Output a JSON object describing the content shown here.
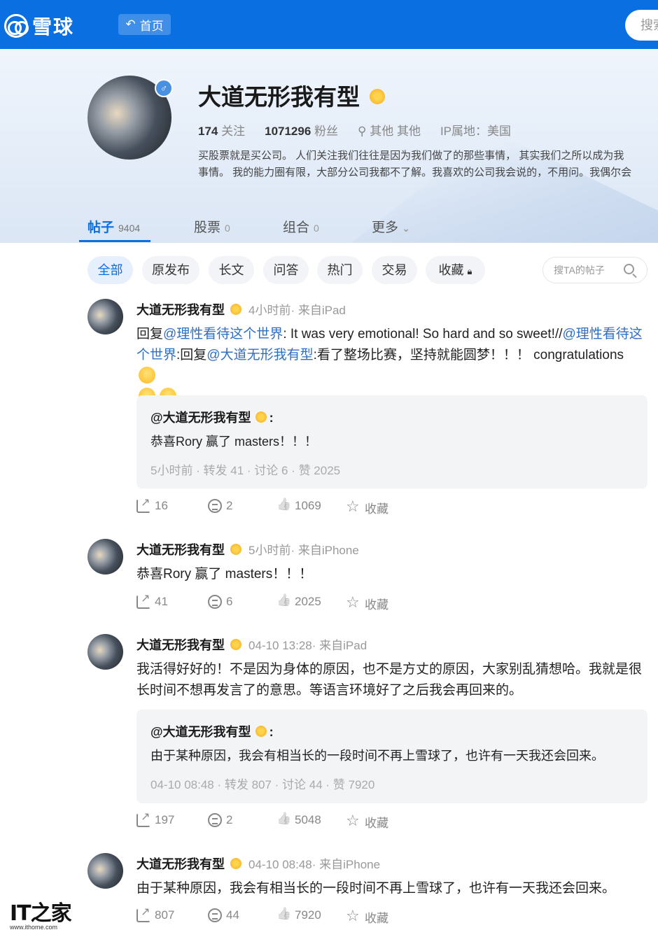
{
  "header": {
    "logo_text": "雪球",
    "home_label": "首页",
    "search_placeholder": "搜索"
  },
  "profile": {
    "name": "大道无形我有型",
    "gender_icon": "♂",
    "following_count": "174",
    "following_label": "关注",
    "followers_count": "1071296",
    "followers_label": "粉丝",
    "location": "其他 其他",
    "ip_location": "IP属地：美国",
    "bio_line1": "买股票就是买公司。 人们关注我们往往是因为我们做了的那些事情， 其实我们之所以成为我",
    "bio_line2": "事情。 我的能力圈有限，大部分公司我都不了解。我喜欢的公司我会说的，不用问。我偶尔会"
  },
  "tabs": [
    {
      "label": "帖子",
      "count": "9404"
    },
    {
      "label": "股票",
      "count": "0"
    },
    {
      "label": "组合",
      "count": "0"
    },
    {
      "label": "更多",
      "count": ""
    }
  ],
  "filters": [
    "全部",
    "原发布",
    "长文",
    "问答",
    "热门",
    "交易",
    "收藏"
  ],
  "post_search_placeholder": "搜TA的帖子",
  "posts": [
    {
      "author": "大道无形我有型",
      "meta": "4小时前· 来自iPad",
      "text": {
        "t1": "回复",
        "m1": "@理性看待这个世界",
        "t2": ": It was very emotional! So hard and so sweet!//",
        "m2": "@理性看待这个世界",
        "t3": ":回复",
        "m3": "@大道无形我有型",
        "t4": ":看了整场比赛，坚持就能圆梦！！！ congratulations"
      },
      "quote": {
        "author": "@大道无形我有型",
        "text": "恭喜Rory 赢了 masters！！！",
        "meta": "5小时前  · 转发 41 · 讨论 6 · 赞 2025"
      },
      "share": "16",
      "comments": "2",
      "likes": "1069",
      "fav": "收藏"
    },
    {
      "author": "大道无形我有型",
      "meta": "5小时前· 来自iPhone",
      "text": "恭喜Rory 赢了 masters！！！",
      "share": "41",
      "comments": "6",
      "likes": "2025",
      "fav": "收藏"
    },
    {
      "author": "大道无形我有型",
      "meta": "04-10 13:28· 来自iPad",
      "text": "我活得好好的！不是因为身体的原因，也不是方丈的原因，大家别乱猜想哈。我就是很长时间不想再发言了的意思。等语言环境好了之后我会再回来的。",
      "quote": {
        "author": "@大道无形我有型",
        "text": "由于某种原因，我会有相当长的一段时间不再上雪球了，也许有一天我还会回来。",
        "meta": "04-10 08:48  · 转发 807 · 讨论 44 · 赞 7920"
      },
      "share": "197",
      "comments": "2",
      "likes": "5048",
      "fav": "收藏"
    },
    {
      "author": "大道无形我有型",
      "meta": "04-10 08:48· 来自iPhone",
      "text": "由于某种原因，我会有相当长的一段时间不再上雪球了，也许有一天我还会回来。",
      "share": "807",
      "comments": "44",
      "likes": "7920",
      "fav": "收藏"
    }
  ],
  "watermark": {
    "logo": "IT之家",
    "url": "www.ithome.com"
  },
  "colors": {
    "brand_blue": "#0a6fe0",
    "link_blue": "#2f6fc2",
    "gold": "#f3a91a"
  }
}
